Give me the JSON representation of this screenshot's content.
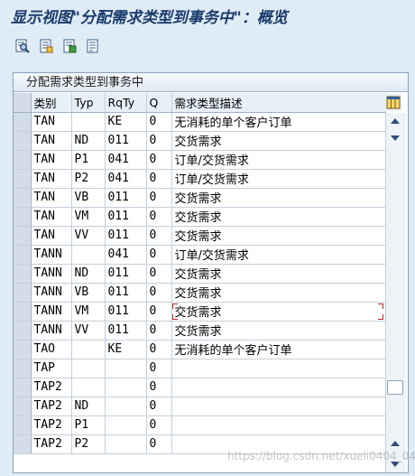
{
  "window": {
    "title": "显示视图\"分配需求类型到事务中\"：概览"
  },
  "toolbar": {
    "buttons": [
      {
        "name": "detail-button",
        "icon": "magnifier-icon"
      },
      {
        "name": "new-entries-button",
        "icon": "document-icon"
      },
      {
        "name": "select-button",
        "icon": "document-green-icon"
      },
      {
        "name": "print-button",
        "icon": "document-lines-icon"
      }
    ]
  },
  "panel": {
    "title": "分配需求类型到事务中"
  },
  "table": {
    "headers": [
      "类别",
      "Typ",
      "RqTy",
      "Q",
      "需求类型描述"
    ],
    "rows": [
      [
        "TAN",
        "",
        "KE",
        "0",
        "无消耗的单个客户订单"
      ],
      [
        "TAN",
        "ND",
        "011",
        "0",
        "交货需求"
      ],
      [
        "TAN",
        "P1",
        "041",
        "0",
        "订单/交货需求"
      ],
      [
        "TAN",
        "P2",
        "041",
        "0",
        "订单/交货需求"
      ],
      [
        "TAN",
        "VB",
        "011",
        "0",
        "交货需求"
      ],
      [
        "TAN",
        "VM",
        "011",
        "0",
        "交货需求"
      ],
      [
        "TAN",
        "VV",
        "011",
        "0",
        "交货需求"
      ],
      [
        "TANN",
        "",
        "041",
        "0",
        "订单/交货需求"
      ],
      [
        "TANN",
        "ND",
        "011",
        "0",
        "交货需求"
      ],
      [
        "TANN",
        "VB",
        "011",
        "0",
        "交货需求"
      ],
      [
        "TANN",
        "VM",
        "011",
        "0",
        "交货需求"
      ],
      [
        "TANN",
        "VV",
        "011",
        "0",
        "交货需求"
      ],
      [
        "TAO",
        "",
        "KE",
        "0",
        "无消耗的单个客户订单"
      ],
      [
        "TAP",
        "",
        "",
        "0",
        ""
      ],
      [
        "TAP2",
        "",
        "",
        "0",
        ""
      ],
      [
        "TAP2",
        "ND",
        "",
        "0",
        ""
      ],
      [
        "TAP2",
        "P1",
        "",
        "0",
        ""
      ],
      [
        "TAP2",
        "P2",
        "",
        "0",
        ""
      ]
    ],
    "focused_row_index": 10
  },
  "watermark": "https://blog.csdn.net/xueli0404_0404",
  "colors": {
    "background": "#dfebf5",
    "title": "#1a3b6b",
    "focus_marker": "#cc2222"
  }
}
